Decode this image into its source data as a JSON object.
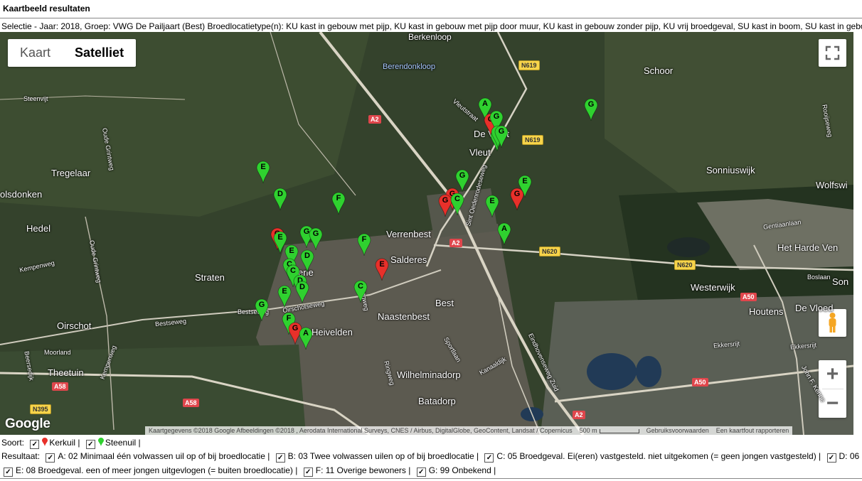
{
  "header": {
    "title": "Kaartbeeld resultaten",
    "selection": "Selectie - Jaar: 2018, Groep: VWG De Pailjaart (Best) Broedlocatietype(n): KU kast in gebouw met pijp, KU kast in gebouw met pijp door muur, KU kast in gebouw zonder pijp, KU vrij broedgeval, SU kast in boom, SU kast in gebou"
  },
  "map": {
    "toggle": {
      "map_label": "Kaart",
      "satellite_label": "Satelliet",
      "active": "Satelliet"
    },
    "zoom_in": "+",
    "zoom_out": "−",
    "logo": "Google",
    "attribution": {
      "data": "Kaartgegevens ©2018 Google Afbeeldingen ©2018 , Aerodata International Surveys, CNES / Airbus, DigitalGlobe, GeoContent, Landsat / Copernicus",
      "scale": "500 m",
      "terms": "Gebruiksvoorwaarden",
      "report": "Een kaartfout rapporteren"
    },
    "colors": {
      "kerkuil": "#e8302a",
      "steenuil": "#2fd12f"
    },
    "places": [
      {
        "id": "berkenloop",
        "text": "Berkenloop"
      },
      {
        "id": "berendonkloop",
        "text": "Berendonkloop"
      },
      {
        "id": "schoor",
        "text": "Schoor"
      },
      {
        "id": "de-vleut",
        "text": "De Vleut"
      },
      {
        "id": "vleut",
        "text": "Vleut"
      },
      {
        "id": "tregelaar",
        "text": "Tregelaar"
      },
      {
        "id": "olsdonken",
        "text": "olsdonken"
      },
      {
        "id": "hedel",
        "text": "Hedel"
      },
      {
        "id": "verrenbest",
        "text": "Verrenbest"
      },
      {
        "id": "salderes",
        "text": "Salderes"
      },
      {
        "id": "straten",
        "text": "Straten"
      },
      {
        "id": "erle",
        "text": "erle"
      },
      {
        "id": "best",
        "text": "Best"
      },
      {
        "id": "naastenbest",
        "text": "Naastenbest"
      },
      {
        "id": "heivelden",
        "text": "Heivelden"
      },
      {
        "id": "oirschot",
        "text": "Oirschot"
      },
      {
        "id": "theetuin",
        "text": "Theetuin"
      },
      {
        "id": "wilhelminadorp",
        "text": "Wilhelminadorp"
      },
      {
        "id": "batadorp",
        "text": "Batadorp"
      },
      {
        "id": "sonniuswijk",
        "text": "Sonniuswijk"
      },
      {
        "id": "wolfswinkel",
        "text": "Wolfswi"
      },
      {
        "id": "het-harde-ven",
        "text": "Het Harde Ven"
      },
      {
        "id": "westerwijk",
        "text": "Westerwijk"
      },
      {
        "id": "houtens",
        "text": "Houtens"
      },
      {
        "id": "de-vloed",
        "text": "De Vloed"
      },
      {
        "id": "son",
        "text": "Son"
      }
    ],
    "roads": [
      {
        "id": "steenvijt",
        "text": "Steenvijt"
      },
      {
        "id": "oude-grintweg",
        "text": "Oude Grintweg"
      },
      {
        "id": "oude-grintweg-2",
        "text": "Oude Grintweg"
      },
      {
        "id": "kempenweg",
        "text": "Kempenweg"
      },
      {
        "id": "bestseweg",
        "text": "Bestseweg"
      },
      {
        "id": "bestseweg-2",
        "text": "Bestseweg"
      },
      {
        "id": "oirschotseweg",
        "text": "Oirschotseweg"
      },
      {
        "id": "moorland",
        "text": "Moorland"
      },
      {
        "id": "kempenweg-2",
        "text": "Kempenweg"
      },
      {
        "id": "vleutstraat",
        "text": "Vleutstraat"
      },
      {
        "id": "sint-oedenrodeseweg",
        "text": "Sint Oedenrodeseweg"
      },
      {
        "id": "ringweg",
        "text": "Ringweg"
      },
      {
        "id": "ringweg-2",
        "text": "Ringweg"
      },
      {
        "id": "sportlaan",
        "text": "Sportlaan"
      },
      {
        "id": "kanaaldijk",
        "text": "Kanaaldijk"
      },
      {
        "id": "eindhovenseweg-zuid",
        "text": "Eindhovenseweg Zuid"
      },
      {
        "id": "gentiaanlaan",
        "text": "Gentiaanlaan"
      },
      {
        "id": "boslaan",
        "text": "Boslaan"
      },
      {
        "id": "ekkersrijt",
        "text": "Ekkersrijt"
      },
      {
        "id": "ekkersrijt-2",
        "text": "Ekkersrijt"
      },
      {
        "id": "john-f-kennedy",
        "text": "John F. Kenne"
      },
      {
        "id": "rooijseweg",
        "text": "Rooijseweg"
      },
      {
        "id": "beersedijk",
        "text": "Beersedijk"
      }
    ],
    "shields": [
      {
        "id": "n619-top",
        "text": "N619",
        "kind": "n"
      },
      {
        "id": "n619-mid",
        "text": "N619",
        "kind": "n"
      },
      {
        "id": "a2-top",
        "text": "A2",
        "kind": "a"
      },
      {
        "id": "a2-mid",
        "text": "A2",
        "kind": "a"
      },
      {
        "id": "n620-a",
        "text": "N620",
        "kind": "n"
      },
      {
        "id": "n620-b",
        "text": "N620",
        "kind": "n"
      },
      {
        "id": "a50-a",
        "text": "A50",
        "kind": "a"
      },
      {
        "id": "a50-b",
        "text": "A50",
        "kind": "a"
      },
      {
        "id": "a58-a",
        "text": "A58",
        "kind": "a"
      },
      {
        "id": "a58-b",
        "text": "A58",
        "kind": "a"
      },
      {
        "id": "n395",
        "text": "N395",
        "kind": "n"
      },
      {
        "id": "a2-bottom",
        "text": "A2",
        "kind": "a"
      }
    ],
    "markers": [
      {
        "label": "A",
        "species": "steenuil"
      },
      {
        "label": "G",
        "species": "kerkuil"
      },
      {
        "label": "G",
        "species": "steenuil"
      },
      {
        "label": "G",
        "species": "steenuil"
      },
      {
        "label": "C",
        "species": "steenuil"
      },
      {
        "label": "G",
        "species": "steenuil"
      },
      {
        "label": "G",
        "species": "steenuil"
      },
      {
        "label": "G",
        "species": "kerkuil"
      },
      {
        "label": "G",
        "species": "kerkuil"
      },
      {
        "label": "C",
        "species": "steenuil"
      },
      {
        "label": "G",
        "species": "steenuil"
      },
      {
        "label": "E",
        "species": "steenuil"
      },
      {
        "label": "G",
        "species": "kerkuil"
      },
      {
        "label": "E",
        "species": "steenuil"
      },
      {
        "label": "A",
        "species": "steenuil"
      },
      {
        "label": "E",
        "species": "steenuil"
      },
      {
        "label": "D",
        "species": "steenuil"
      },
      {
        "label": "F",
        "species": "steenuil"
      },
      {
        "label": "G",
        "species": "kerkuil"
      },
      {
        "label": "E",
        "species": "steenuil"
      },
      {
        "label": "G",
        "species": "steenuil"
      },
      {
        "label": "G",
        "species": "steenuil"
      },
      {
        "label": "F",
        "species": "steenuil"
      },
      {
        "label": "E",
        "species": "steenuil"
      },
      {
        "label": "D",
        "species": "steenuil"
      },
      {
        "label": "C",
        "species": "steenuil"
      },
      {
        "label": "C",
        "species": "steenuil"
      },
      {
        "label": "D",
        "species": "steenuil"
      },
      {
        "label": "E",
        "species": "steenuil"
      },
      {
        "label": "D",
        "species": "steenuil"
      },
      {
        "label": "E",
        "species": "kerkuil"
      },
      {
        "label": "C",
        "species": "steenuil"
      },
      {
        "label": "G",
        "species": "steenuil"
      },
      {
        "label": "F",
        "species": "steenuil"
      },
      {
        "label": "G",
        "species": "kerkuil"
      },
      {
        "label": "A",
        "species": "steenuil"
      }
    ]
  },
  "legend": {
    "species_label": "Soort:",
    "species": [
      {
        "name": "Kerkuil",
        "checked": true,
        "color": "#e8302a"
      },
      {
        "name": "Steenuil",
        "checked": true,
        "color": "#2fd12f"
      }
    ],
    "result_label": "Resultaat:",
    "results_line1": [
      {
        "text": "A: 02 Minimaal één volwassen uil op of bij broedlocatie",
        "checked": true
      },
      {
        "text": "B: 03 Twee volwassen uilen op of bij broedlocatie",
        "checked": true
      },
      {
        "text": "C: 05 Broedgeval. Ei(eren) vastgesteld. niet uitgekomen (= geen jongen vastgesteld)",
        "checked": true
      },
      {
        "text": "D: 06",
        "checked": true
      }
    ],
    "results_line2": [
      {
        "text": "E: 08 Broedgeval. een of meer jongen uitgevlogen (= buiten broedlocatie)",
        "checked": true
      },
      {
        "text": "F: 11 Overige bewoners",
        "checked": true
      },
      {
        "text": "G: 99 Onbekend",
        "checked": true
      }
    ]
  }
}
